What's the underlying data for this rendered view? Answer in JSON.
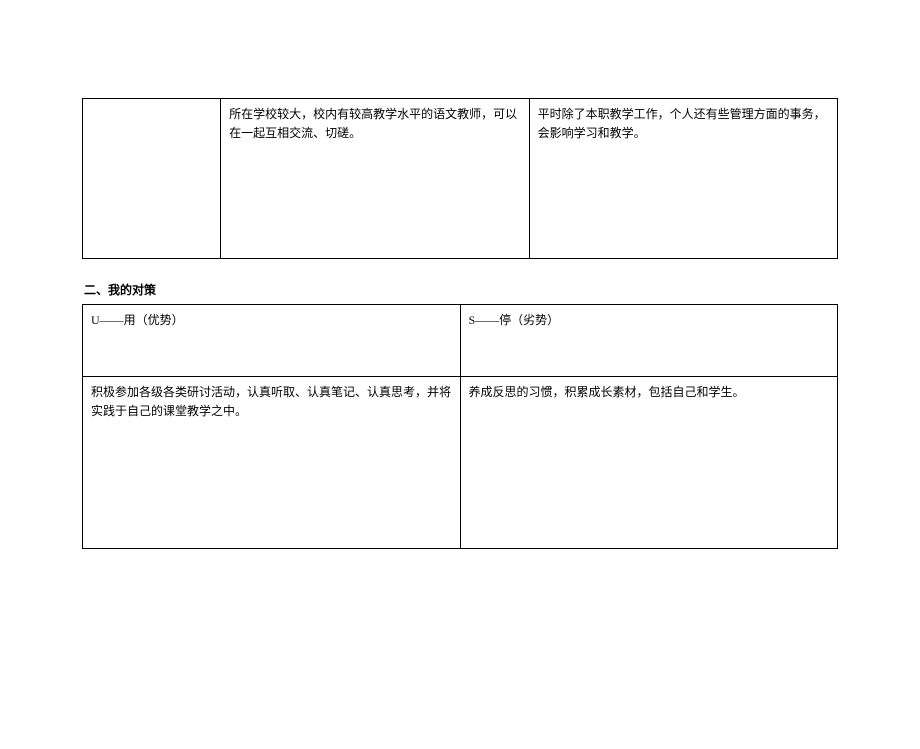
{
  "table1": {
    "col1": "",
    "col2": "所在学校较大，校内有较高教学水平的语文教师，可以在一起互相交流、切磋。",
    "col3": "平时除了本职教学工作，个人还有些管理方面的事务，会影响学习和教学。"
  },
  "section_title": "二、我的对策",
  "table2": {
    "header_left": "U——用（优势）",
    "header_right": "S——停（劣势）",
    "content_left": "积极参加各级各类研讨活动，认真听取、认真笔记、认真思考，并将实践于自己的课堂教学之中。",
    "content_right": "养成反思的习惯，积累成长素材，包括自己和学生。"
  }
}
